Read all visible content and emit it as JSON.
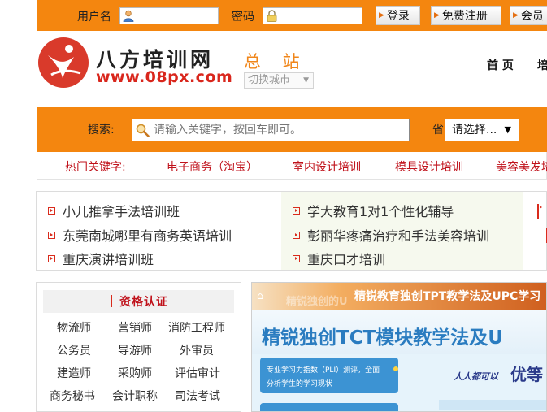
{
  "login": {
    "username_label": "用户名",
    "password_label": "密码",
    "login_button": "登录",
    "register_button": "免费注册",
    "member_button": "会员"
  },
  "logo": {
    "name": "八方培训网",
    "url": "www.08px.com"
  },
  "site": {
    "station": "总 站",
    "switch_city": "切换城市"
  },
  "nav": [
    "首 页",
    "培"
  ],
  "search": {
    "label": "搜索:",
    "placeholder": "请输入关键字，按回车即可。",
    "province_label": "省",
    "province_value": "请选择..."
  },
  "hot_keywords": {
    "label": "热门关键字:",
    "items": [
      "电子商务（淘宝）",
      "室内设计培训",
      "模具设计培训",
      "美容美发培"
    ]
  },
  "link_grid": {
    "col1": [
      "小儿推拿手法培训班",
      "东莞南城哪里有商务英语培训",
      "重庆演讲培训班"
    ],
    "col2": [
      "学大教育1对1个性化辅导",
      "彭丽华疼痛治疗和手法美容培训",
      "重庆口才培训"
    ]
  },
  "category": {
    "title": "资格认证",
    "rows": [
      [
        "物流师",
        "营销师",
        "消防工程师"
      ],
      [
        "公务员",
        "导游师",
        "外审员"
      ],
      [
        "建造师",
        "采购师",
        "评估审计"
      ],
      [
        "商务秘书",
        "会计职称",
        "司法考试"
      ]
    ]
  },
  "banner": {
    "top_text": "精锐教育独创TPT教学法及UPC学习",
    "faded_text": "精锐独创的U",
    "headline": "精锐独创TCT模块教学法及U",
    "box_text_1": "专业学习力指数（PLI）测评，全面",
    "box_text_2": "分析学生的学习现状",
    "slogan_1": "人人都可以",
    "slogan_2": "优等"
  },
  "colors": {
    "orange": "#f4860f",
    "red": "#d92b1c",
    "banner_blue": "#2a7cc0"
  }
}
